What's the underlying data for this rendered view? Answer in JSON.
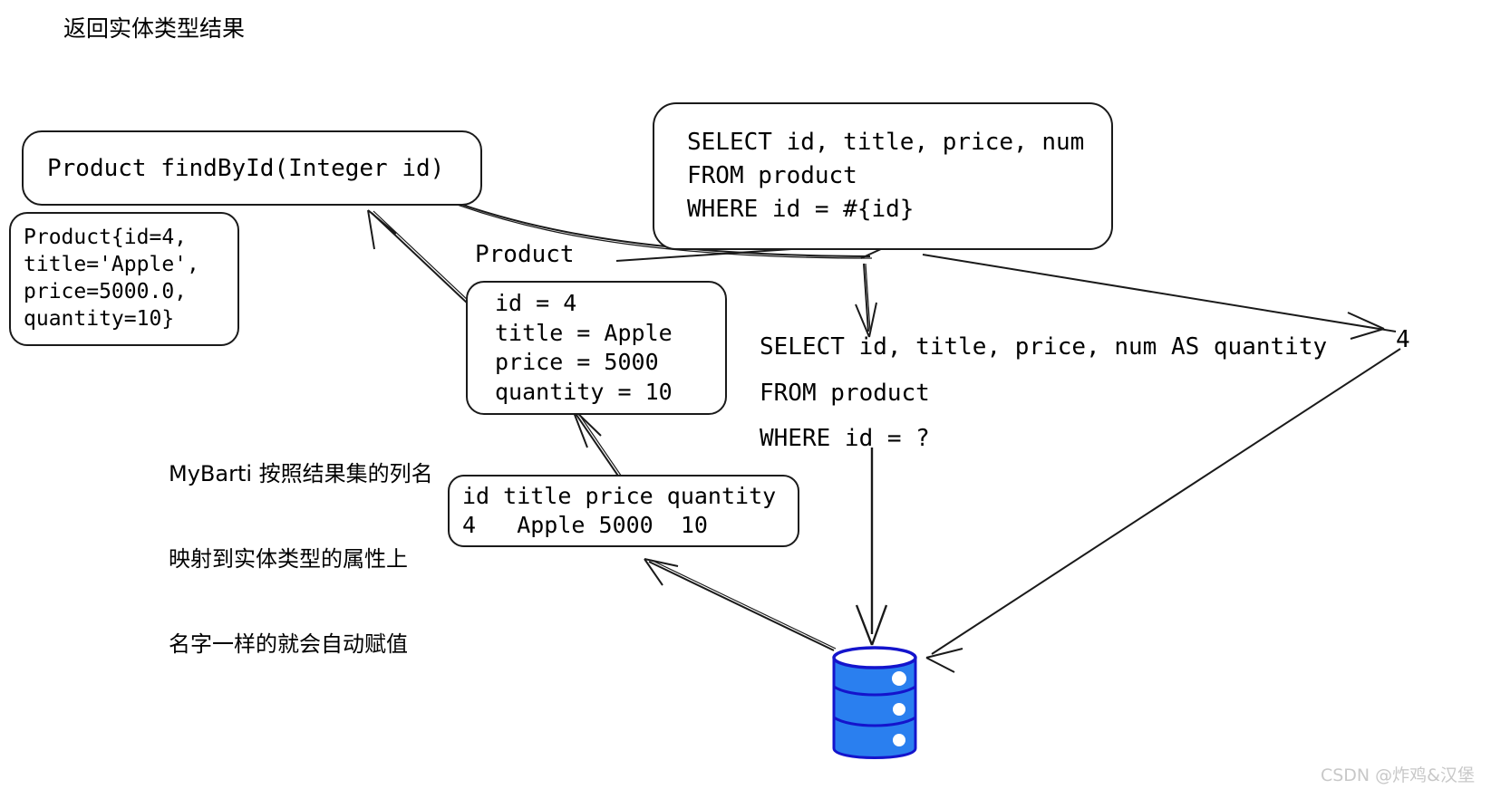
{
  "page": {
    "title": "返回实体类型结果",
    "watermark": "CSDN @炸鸡&汉堡",
    "background": "#ffffff",
    "ink_color": "#1a1a1a",
    "db_color": "#2a7fef",
    "db_stroke": "#1414cc"
  },
  "boxes": {
    "method_signature": "Product findById(Integer id)",
    "product_tostring": "Product{id=4,\ntitle='Apple',\nprice=5000.0,\nquantity=10}",
    "sql_mapper": "SELECT id, title, price, num\nFROM product\nWHERE id = #{id}",
    "entity_label": "Product",
    "entity_fields": "id = 4\ntitle = Apple\nprice = 5000\nquantity = 10",
    "sql_runtime": "SELECT id, title, price, num AS quantity\nFROM product\nWHERE id = ?",
    "resultset": "id title price quantity\n4   Apple 5000  10",
    "param_value": "4"
  },
  "annotations": {
    "mapping_note_line1": "MyBarti 按照结果集的列名",
    "mapping_note_line2": "映射到实体类型的属性上",
    "mapping_note_line3": "名字一样的就会自动赋值"
  },
  "entity_fields_list": [
    {
      "name": "id",
      "value": "4"
    },
    {
      "name": "title",
      "value": "Apple"
    },
    {
      "name": "price",
      "value": "5000"
    },
    {
      "name": "quantity",
      "value": "10"
    }
  ],
  "resultset_table": {
    "columns": [
      "id",
      "title",
      "price",
      "quantity"
    ],
    "rows": [
      [
        "4",
        "Apple",
        "5000",
        "10"
      ]
    ]
  },
  "icons": {
    "database": "database-cylinder-icon"
  }
}
